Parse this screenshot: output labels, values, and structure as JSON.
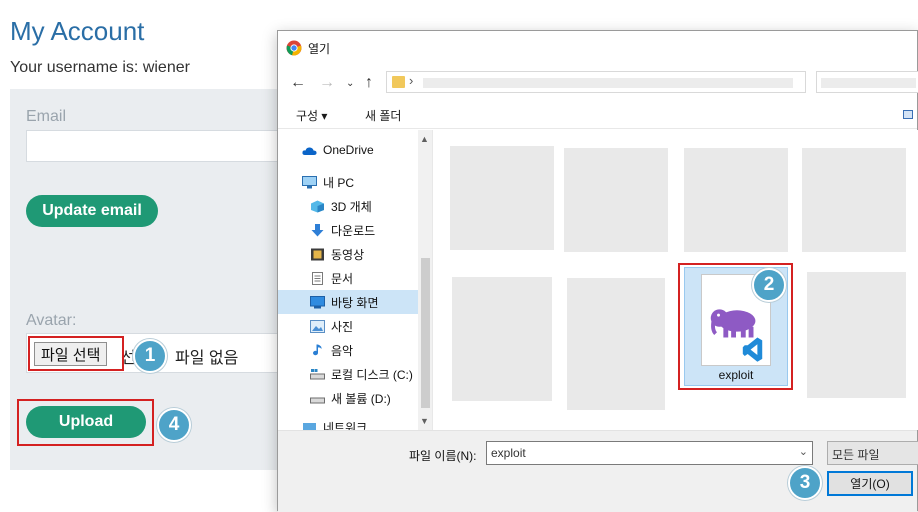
{
  "page": {
    "title": "My Account",
    "username_line": "Your username is: wiener",
    "email_label": "Email",
    "update_email_button": "Update email",
    "avatar_label": "Avatar:",
    "file_button": "파일 선택",
    "file_status_partial": "선",
    "file_status": "파일 없음",
    "upload_button": "Upload"
  },
  "dialog": {
    "title": "열기",
    "toolbar": {
      "organize": "구성 ▾",
      "new_folder": "새 폴더"
    },
    "nav_items": [
      {
        "label": "OneDrive",
        "icon": "cloud-icon"
      },
      {
        "label": "내 PC",
        "icon": "computer-icon"
      },
      {
        "label": "3D 개체",
        "icon": "cube-icon"
      },
      {
        "label": "다운로드",
        "icon": "download-icon"
      },
      {
        "label": "동영상",
        "icon": "video-icon"
      },
      {
        "label": "문서",
        "icon": "document-icon"
      },
      {
        "label": "바탕 화면",
        "icon": "desktop-icon",
        "selected": true
      },
      {
        "label": "사진",
        "icon": "pictures-icon"
      },
      {
        "label": "음악",
        "icon": "music-icon"
      },
      {
        "label": "로컬 디스크 (C:)",
        "icon": "drive-icon"
      },
      {
        "label": "새 볼륨 (D:)",
        "icon": "drive-icon"
      },
      {
        "label": "네트워크",
        "icon": "network-icon"
      }
    ],
    "selected_file": "exploit",
    "filename_label": "파일 이름(N):",
    "filename_value": "exploit",
    "file_type": "모든 파일",
    "open_button": "열기(O)"
  },
  "annotations": {
    "steps": [
      "1",
      "2",
      "3",
      "4"
    ],
    "highlight_color": "#d42121",
    "badge_color": "#4ea3c8"
  },
  "colors": {
    "brand_green": "#1f9975",
    "title_blue": "#2a6ea6",
    "selection": "#cce4f7"
  }
}
